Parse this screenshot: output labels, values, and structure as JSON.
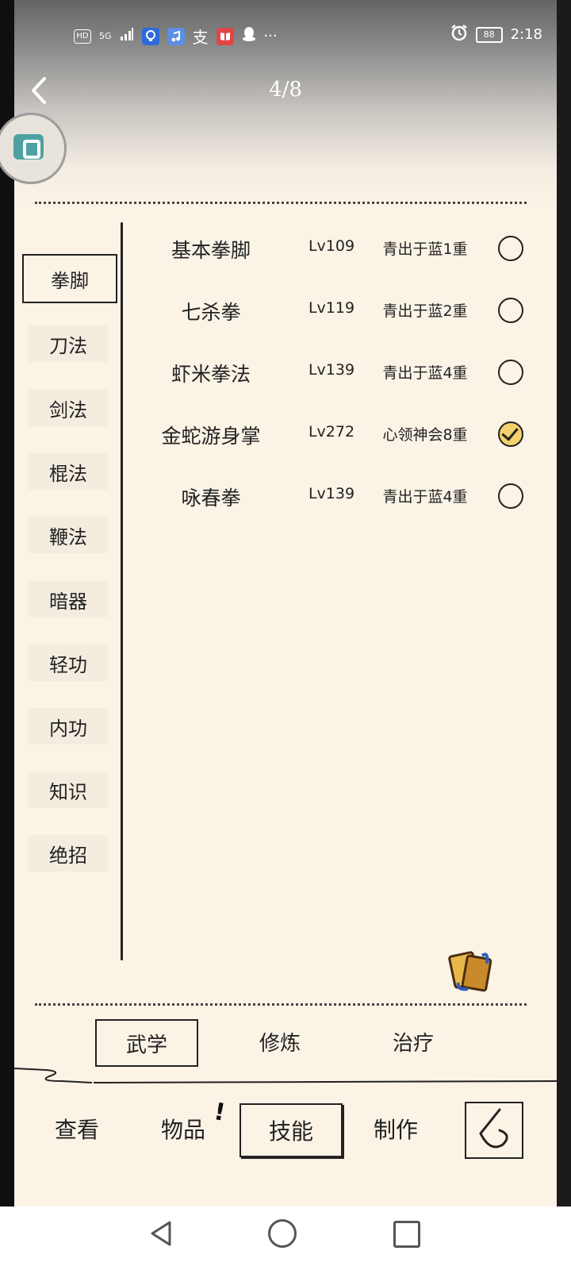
{
  "status_bar": {
    "left_icons": [
      "HD",
      "5G",
      "signal-icon",
      "lightbulb-app-icon",
      "music-app-icon",
      "alipay-icon",
      "book-app-icon",
      "qq-icon",
      "more-dots-icon"
    ],
    "hd_label": "HD",
    "net_label": "5G",
    "alipay_label": "支",
    "more_label": "···",
    "alarm_icon": "alarm-icon",
    "battery": "88",
    "time": "2:18"
  },
  "header": {
    "title": "4/8"
  },
  "categories": [
    {
      "label": "拳脚",
      "active": true
    },
    {
      "label": "刀法"
    },
    {
      "label": "剑法"
    },
    {
      "label": "棍法"
    },
    {
      "label": "鞭法"
    },
    {
      "label": "暗器"
    },
    {
      "label": "轻功"
    },
    {
      "label": "内功"
    },
    {
      "label": "知识"
    },
    {
      "label": "绝招"
    }
  ],
  "skills": [
    {
      "name": "基本拳脚",
      "level": "Lv109",
      "rank": "青出于蓝1重",
      "equipped": false
    },
    {
      "name": "七杀拳",
      "level": "Lv119",
      "rank": "青出于蓝2重",
      "equipped": false
    },
    {
      "name": "虾米拳法",
      "level": "Lv139",
      "rank": "青出于蓝4重",
      "equipped": false
    },
    {
      "name": "金蛇游身掌",
      "level": "Lv272",
      "rank": "心领神会8重",
      "equipped": true
    },
    {
      "name": "咏春拳",
      "level": "Lv139",
      "rank": "青出于蓝4重",
      "equipped": false
    }
  ],
  "sub_tabs": [
    {
      "label": "武学",
      "active": true
    },
    {
      "label": "修炼"
    },
    {
      "label": "治疗"
    }
  ],
  "bottom_tabs": [
    {
      "label": "查看"
    },
    {
      "label": "物品",
      "badge": "!"
    },
    {
      "label": "技能",
      "active": true
    },
    {
      "label": "制作"
    }
  ],
  "colors": {
    "paper": "#fbf3e6",
    "ink": "#222222",
    "check_fill": "#f3d16c"
  }
}
